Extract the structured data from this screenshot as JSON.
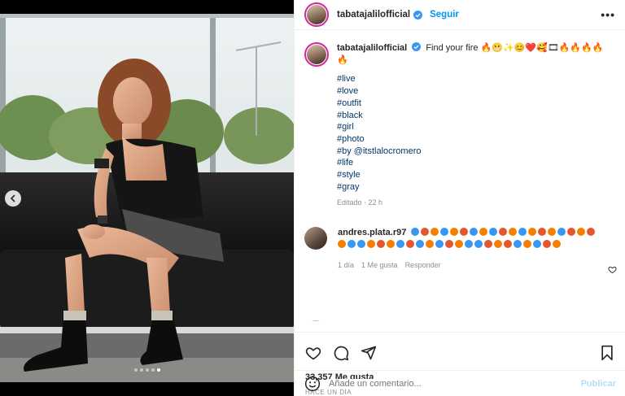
{
  "post": {
    "username": "tabatajalilofficial",
    "follow_label": "Seguir",
    "more_label": "•••"
  },
  "caption": {
    "username": "tabatajalilofficial",
    "text": "Find your fire",
    "emoji_text": "🔥😬✨😊❤️🥰🎞🔥🔥🔥🔥🔥",
    "tags": [
      "#live",
      "#love",
      "#outfit",
      "#black",
      "#girl",
      "#photo",
      "#by @itstlalocromero",
      "#life",
      "#style",
      "#gray"
    ],
    "meta": "Editado · 22 h"
  },
  "comment": {
    "username": "andres.plata.r97",
    "emoji_colors": [
      "#3897f0",
      "#e4572e",
      "#f77f00",
      "#3897f0",
      "#f77f00",
      "#e4572e",
      "#3897f0",
      "#f77f00",
      "#3897f0",
      "#e4572e",
      "#f77f00",
      "#3897f0",
      "#f77f00",
      "#e4572e",
      "#f77f00",
      "#3897f0",
      "#e4572e",
      "#f77f00",
      "#e4572e",
      "#f77f00",
      "#3897f0",
      "#3897f0",
      "#f77f00",
      "#e4572e",
      "#f77f00",
      "#3897f0",
      "#e4572e",
      "#3897f0",
      "#f77f00",
      "#3897f0",
      "#e4572e",
      "#f77f00",
      "#3897f0",
      "#3897f0",
      "#e4572e",
      "#f77f00",
      "#e4572e",
      "#3897f0",
      "#f77f00",
      "#3897f0",
      "#e4572e",
      "#f77f00"
    ],
    "age": "1 día",
    "likes": "1 Me gusta",
    "reply": "Responder"
  },
  "actions": {
    "likes_count": "33,357 Me gusta",
    "timestamp": "HACE UN DÍA"
  },
  "add_comment": {
    "placeholder": "Añade un comentario...",
    "post_label": "Publicar"
  },
  "carousel": {
    "slide_count": 5,
    "active_index": 4
  },
  "colors": {
    "link": "#00376b",
    "accent": "#0095f6",
    "muted": "#8e8e8e"
  }
}
